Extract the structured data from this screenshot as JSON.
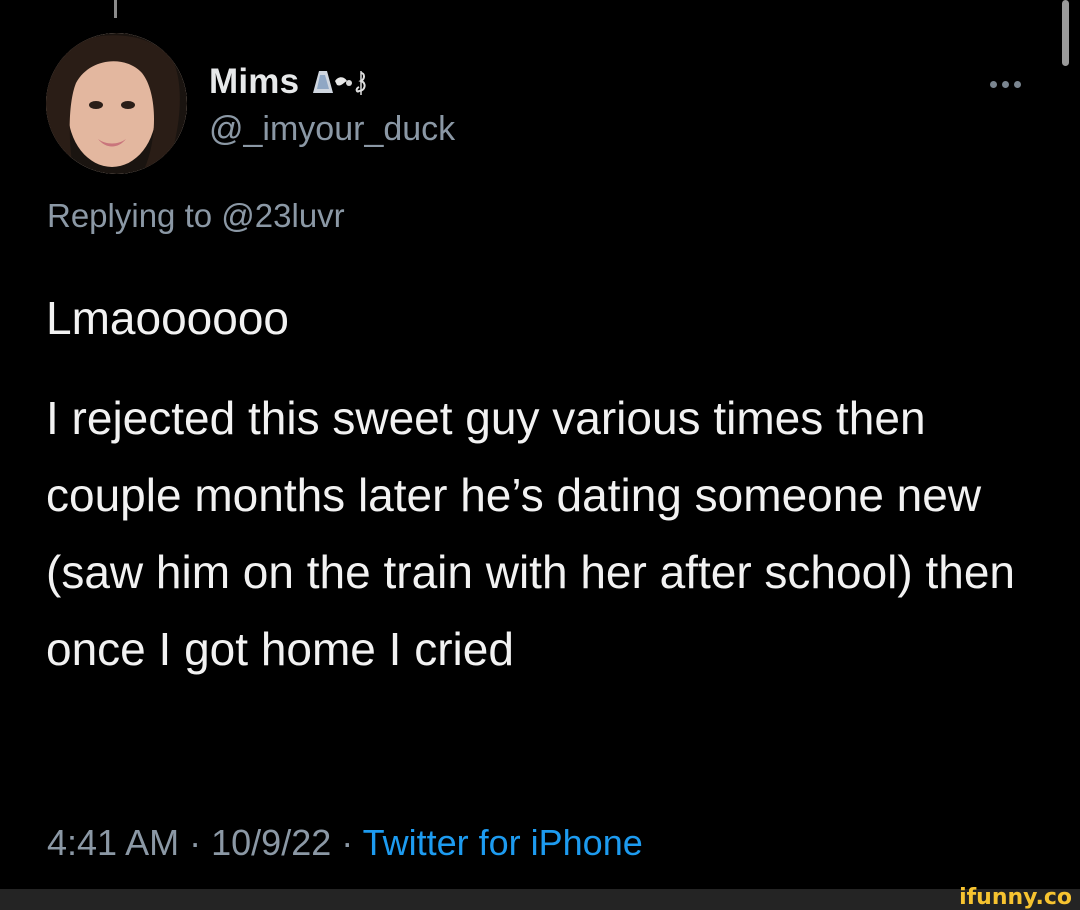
{
  "tweet": {
    "display_name": "Mims",
    "name_emoji_icon": "nazar-amulet-dove-music-note-emoji",
    "handle": "@_imyour_duck",
    "more_icon": "ellipsis-icon",
    "replying_prefix": "Replying to",
    "replying_to": "@23luvr",
    "text_paragraphs": [
      "Lmaoooooo",
      "I rejected this sweet guy various times then couple months later he’s dating someone new (saw him on the train with her after school) then once I got home I cried"
    ],
    "time": "4:41 AM",
    "separator": "·",
    "date": "10/9/22",
    "source": "Twitter for iPhone"
  },
  "watermark": "ifunny.co",
  "colors": {
    "background": "#000000",
    "text": "#e7e9ea",
    "secondary": "#8b98a5",
    "link": "#1d9bf0",
    "watermark": "#f6c330"
  }
}
